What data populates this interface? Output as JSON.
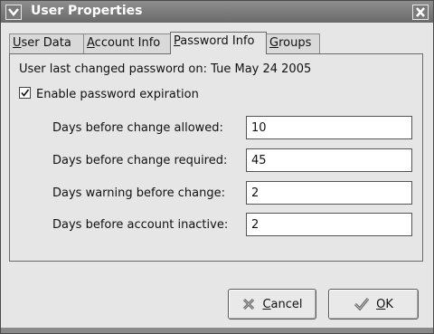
{
  "window": {
    "title": "User Properties",
    "menu_icon": "chevron-down-icon",
    "close_icon": "close-icon"
  },
  "tabs": [
    {
      "label_u": "U",
      "label_rest": "ser Data",
      "active": false
    },
    {
      "label_u": "A",
      "label_rest": "ccount Info",
      "active": false
    },
    {
      "label_u": "P",
      "label_rest": "assword Info",
      "active": true
    },
    {
      "label_u": "G",
      "label_rest": "roups",
      "active": false
    }
  ],
  "password_info": {
    "last_changed_label": "User last changed password on:",
    "last_changed_value": "Tue  May  24  2005",
    "expiration_checkbox": {
      "label": "Enable password expiration",
      "checked": true
    },
    "fields": [
      {
        "label": "Days before change allowed:",
        "value": "10"
      },
      {
        "label": "Days before change required:",
        "value": "45"
      },
      {
        "label": "Days warning before change:",
        "value": "2"
      },
      {
        "label": "Days before account inactive:",
        "value": "2"
      }
    ]
  },
  "buttons": {
    "cancel": {
      "underline": "C",
      "rest": "ancel",
      "icon": "cancel-x-icon"
    },
    "ok": {
      "underline": "O",
      "rest": "K",
      "icon": "checkmark-icon"
    }
  },
  "colors": {
    "titlebar": "#7a7a7a",
    "window_bg": "#e6e6e6",
    "input_bg": "#ffffff"
  }
}
